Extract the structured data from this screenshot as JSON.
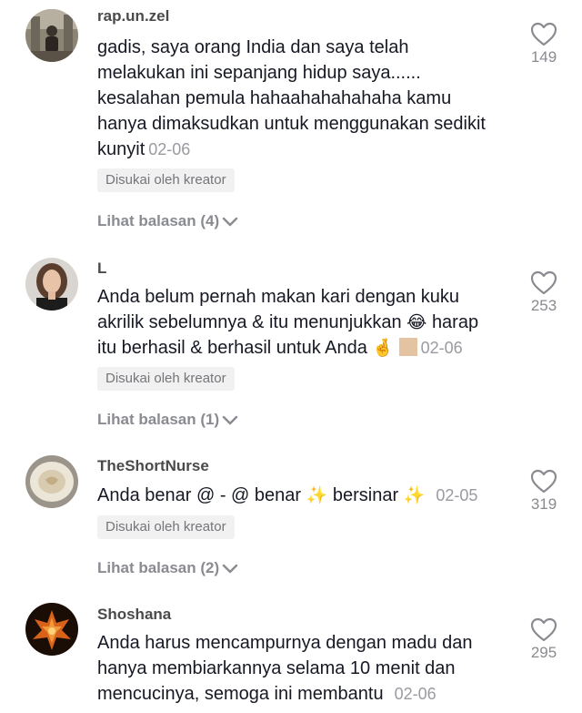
{
  "comments": [
    {
      "username": "rap.un.zel",
      "lines": [
        " gadis, saya orang India dan saya telah",
        "melakukan ini sepanjang hidup saya......",
        "kesalahan pemula hahaahahahahaha kamu",
        "hanya dimaksudkan untuk menggunakan sedikit",
        "kunyit"
      ],
      "date": "02-06",
      "badge": "Disukai oleh kreator",
      "replies": "Lihat balasan (4)",
      "likes": "149"
    },
    {
      "username": "L",
      "lines": [
        "Anda belum pernah makan kari dengan kuku",
        "akrilik sebelumnya & itu menunjukkan",
        "harap",
        "itu berhasil & berhasil untuk Anda"
      ],
      "emoji_laugh": "😂",
      "emoji_fingers": "🤞",
      "date": "02-06",
      "badge": "Disukai oleh kreator",
      "replies": "Lihat balasan (1)",
      "likes": "253"
    },
    {
      "username": "TheShortNurse",
      "text_a": "Anda benar @ - @ benar",
      "text_b": "bersinar",
      "emoji_sparkles": "✨",
      "date": "02-05",
      "badge": "Disukai oleh kreator",
      "replies": "Lihat balasan (2)",
      "likes": "319"
    },
    {
      "username": "Shoshana",
      "lines": [
        "Anda harus mencampurnya dengan madu dan",
        "hanya membiarkannya selama 10 menit dan",
        "mencucinya, semoga ini membantu"
      ],
      "date": "02-06",
      "likes": "295"
    }
  ],
  "colors": {
    "text": "#161823",
    "secondary": "#8a8b91",
    "badge_bg": "#f1f1f2"
  },
  "icons": [
    "heart-outline-icon",
    "chevron-down-icon"
  ]
}
